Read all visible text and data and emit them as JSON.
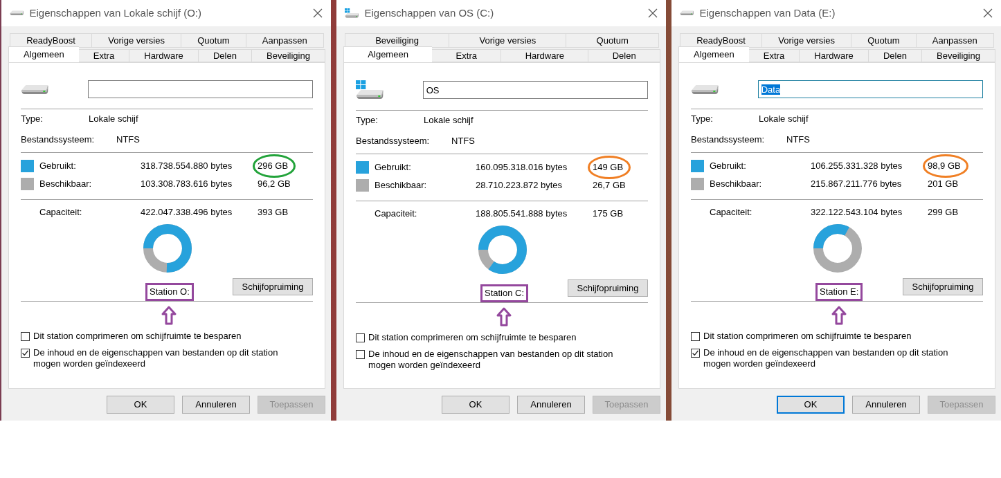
{
  "dialogs": [
    {
      "title": "Eigenschappen van Lokale schijf (O:)",
      "drive_icon": {
        "kind": "plain"
      },
      "tab_rows": [
        [
          {
            "label": "ReadyBoost",
            "selected": false
          },
          {
            "label": "Vorige versies",
            "selected": false
          },
          {
            "label": "Quotum",
            "selected": false
          },
          {
            "label": "Aanpassen",
            "selected": false
          }
        ],
        [
          {
            "label": "Algemeen",
            "selected": true
          },
          {
            "label": "Extra",
            "selected": false
          },
          {
            "label": "Hardware",
            "selected": false
          },
          {
            "label": "Delen",
            "selected": false
          },
          {
            "label": "Beveiliging",
            "selected": false
          }
        ]
      ],
      "name_field": {
        "focused": false
      },
      "type": {
        "label": "Type:",
        "value": "Lokale schijf"
      },
      "file_system": {
        "label": "Bestandssysteem:",
        "value": "NTFS"
      },
      "usage": [
        {
          "label": "Gebruikt:",
          "bytes": "318.738.554.880 bytes",
          "size": "296 GB",
          "color": "#27a2dc",
          "highlight": {
            "color": "#22a33a"
          }
        },
        {
          "label": "Beschikbaar:",
          "bytes": "103.308.783.616 bytes",
          "size": "96,2 GB",
          "color": "#adadad"
        }
      ],
      "capacity": {
        "label": "Capaciteit:",
        "bytes": "422.047.338.496 bytes",
        "size": "393 GB"
      },
      "donut": {
        "level": 0.755
      },
      "station": {
        "label": "Station O:"
      },
      "cleanup_button": "Schijfopruiming",
      "checkboxes": [
        {
          "label": "Dit station comprimeren om schijfruimte te besparen",
          "checked": false
        },
        {
          "label": "De inhoud en de eigenschappen van bestanden op dit station mogen worden geïndexeerd",
          "checked": true
        }
      ],
      "buttons": [
        {
          "label": "OK",
          "disabled": false,
          "default": false
        },
        {
          "label": "Annuleren",
          "disabled": false,
          "default": false
        },
        {
          "label": "Toepassen",
          "disabled": true,
          "default": false
        }
      ]
    },
    {
      "title": "Eigenschappen van OS (C:)",
      "drive_icon": {
        "kind": "system"
      },
      "tab_rows": [
        [
          {
            "label": "Beveiliging",
            "selected": false
          },
          {
            "label": "Vorige versies",
            "selected": false
          },
          {
            "label": "Quotum",
            "selected": false
          }
        ],
        [
          {
            "label": "Algemeen",
            "selected": true
          },
          {
            "label": "Extra",
            "selected": false
          },
          {
            "label": "Hardware",
            "selected": false
          },
          {
            "label": "Delen",
            "selected": false
          }
        ]
      ],
      "name_field": {
        "value": "OS",
        "focused": false
      },
      "type": {
        "label": "Type:",
        "value": "Lokale schijf"
      },
      "file_system": {
        "label": "Bestandssysteem:",
        "value": "NTFS"
      },
      "usage": [
        {
          "label": "Gebruikt:",
          "bytes": "160.095.318.016 bytes",
          "size": "149 GB",
          "color": "#27a2dc",
          "highlight": {
            "color": "#f07f24"
          }
        },
        {
          "label": "Beschikbaar:",
          "bytes": "28.710.223.872 bytes",
          "size": "26,7 GB",
          "color": "#adadad"
        }
      ],
      "capacity": {
        "label": "Capaciteit:",
        "bytes": "188.805.541.888 bytes",
        "size": "175 GB"
      },
      "donut": {
        "level": 0.848
      },
      "station": {
        "label": "Station C:"
      },
      "cleanup_button": "Schijfopruiming",
      "checkboxes": [
        {
          "label": "Dit station comprimeren om schijfruimte te besparen",
          "checked": false
        },
        {
          "label": "De inhoud en de eigenschappen van bestanden op dit station mogen worden geïndexeerd",
          "checked": false
        }
      ],
      "buttons": [
        {
          "label": "OK",
          "disabled": false,
          "default": false
        },
        {
          "label": "Annuleren",
          "disabled": false,
          "default": false
        },
        {
          "label": "Toepassen",
          "disabled": true,
          "default": false
        }
      ]
    },
    {
      "title": "Eigenschappen van Data (E:)",
      "drive_icon": {
        "kind": "plain"
      },
      "tab_rows": [
        [
          {
            "label": "ReadyBoost",
            "selected": false
          },
          {
            "label": "Vorige versies",
            "selected": false
          },
          {
            "label": "Quotum",
            "selected": false
          },
          {
            "label": "Aanpassen",
            "selected": false
          }
        ],
        [
          {
            "label": "Algemeen",
            "selected": true
          },
          {
            "label": "Extra",
            "selected": false
          },
          {
            "label": "Hardware",
            "selected": false
          },
          {
            "label": "Delen",
            "selected": false
          },
          {
            "label": "Beveiliging",
            "selected": false
          }
        ]
      ],
      "name_field": {
        "value": "Data",
        "focused": true
      },
      "type": {
        "label": "Type:",
        "value": "Lokale schijf"
      },
      "file_system": {
        "label": "Bestandssysteem:",
        "value": "NTFS"
      },
      "usage": [
        {
          "label": "Gebruikt:",
          "bytes": "106.255.331.328 bytes",
          "size": "98,9 GB",
          "color": "#27a2dc",
          "highlight": {
            "color": "#f07f24"
          }
        },
        {
          "label": "Beschikbaar:",
          "bytes": "215.867.211.776 bytes",
          "size": "201 GB",
          "color": "#adadad"
        }
      ],
      "capacity": {
        "label": "Capaciteit:",
        "bytes": "322.122.543.104 bytes",
        "size": "299 GB"
      },
      "donut": {
        "level": 0.33
      },
      "station": {
        "label": "Station E:"
      },
      "cleanup_button": "Schijfopruiming",
      "checkboxes": [
        {
          "label": "Dit station comprimeren om schijfruimte te besparen",
          "checked": false
        },
        {
          "label": "De inhoud en de eigenschappen van bestanden op dit station mogen worden geïndexeerd",
          "checked": true
        }
      ],
      "buttons": [
        {
          "label": "OK",
          "disabled": false,
          "default": true
        },
        {
          "label": "Annuleren",
          "disabled": false,
          "default": false
        },
        {
          "label": "Toepassen",
          "disabled": true,
          "default": false
        }
      ]
    }
  ]
}
